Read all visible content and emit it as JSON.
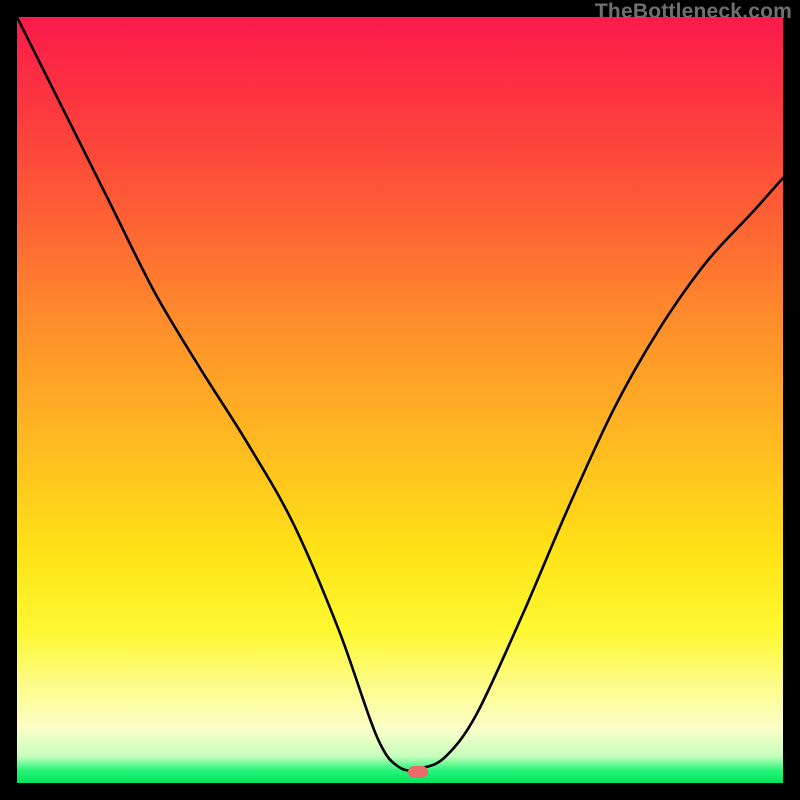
{
  "watermark": "TheBottleneck.com",
  "marker": {
    "x_frac": 0.523,
    "y_frac": 0.985,
    "color": "#e96a69"
  },
  "chart_data": {
    "type": "line",
    "title": "",
    "xlabel": "",
    "ylabel": "",
    "xlim": [
      0,
      1
    ],
    "ylim": [
      0,
      1
    ],
    "grid": false,
    "series": [
      {
        "name": "bottleneck-curve",
        "x": [
          0.0,
          0.06,
          0.12,
          0.18,
          0.24,
          0.3,
          0.36,
          0.42,
          0.47,
          0.5,
          0.53,
          0.56,
          0.6,
          0.66,
          0.72,
          0.78,
          0.84,
          0.9,
          0.96,
          1.0
        ],
        "y": [
          1.0,
          0.88,
          0.76,
          0.64,
          0.54,
          0.445,
          0.34,
          0.2,
          0.06,
          0.02,
          0.02,
          0.035,
          0.09,
          0.22,
          0.36,
          0.49,
          0.595,
          0.68,
          0.745,
          0.79
        ]
      }
    ],
    "background_gradient": {
      "top": "#fb1a4b",
      "upper_mid": "#fe8e2b",
      "mid": "#ffe317",
      "lower": "#fdfd92",
      "bottom": "#02e65a"
    },
    "annotations": [
      {
        "kind": "marker",
        "shape": "pill",
        "x": 0.523,
        "y": 0.015,
        "color": "#e96a69"
      }
    ]
  }
}
